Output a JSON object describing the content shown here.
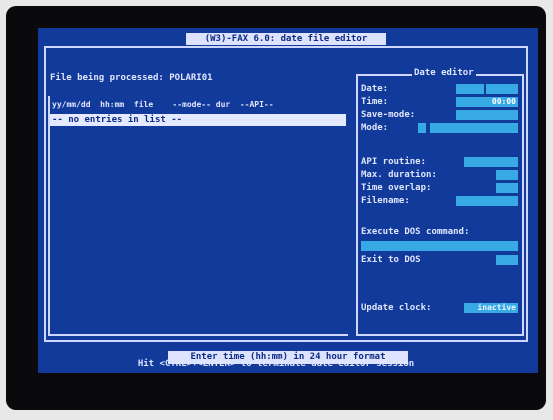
{
  "window": {
    "title": "(W3)-FAX 6.0: date file editor"
  },
  "header": {
    "file_label": "File being processed: POLARI01"
  },
  "list": {
    "columns": "yy/mm/dd  hh:mm  file    --mode-- dur  --API--",
    "empty_row": "-- no entries in list --"
  },
  "editor": {
    "title": "Date editor",
    "labels": {
      "date": "Date:",
      "time": "Time:",
      "save_mode": "Save-mode:",
      "mode": "Mode:",
      "api_routine": "API routine:",
      "max_duration": "Max. duration:",
      "time_overlap": "Time overlap:",
      "filename": "Filename:",
      "execute_dos": "Execute DOS command:",
      "exit_to_dos": "Exit to DOS",
      "update_clock": "Update clock:"
    },
    "values": {
      "time": "00:00",
      "update_clock": "inactive"
    }
  },
  "status": {
    "message": "Enter time (hh:mm) in 24 hour format"
  },
  "footer": {
    "hint": "Hit <CTRL>+<ENTER> to terminate date editor session"
  }
}
